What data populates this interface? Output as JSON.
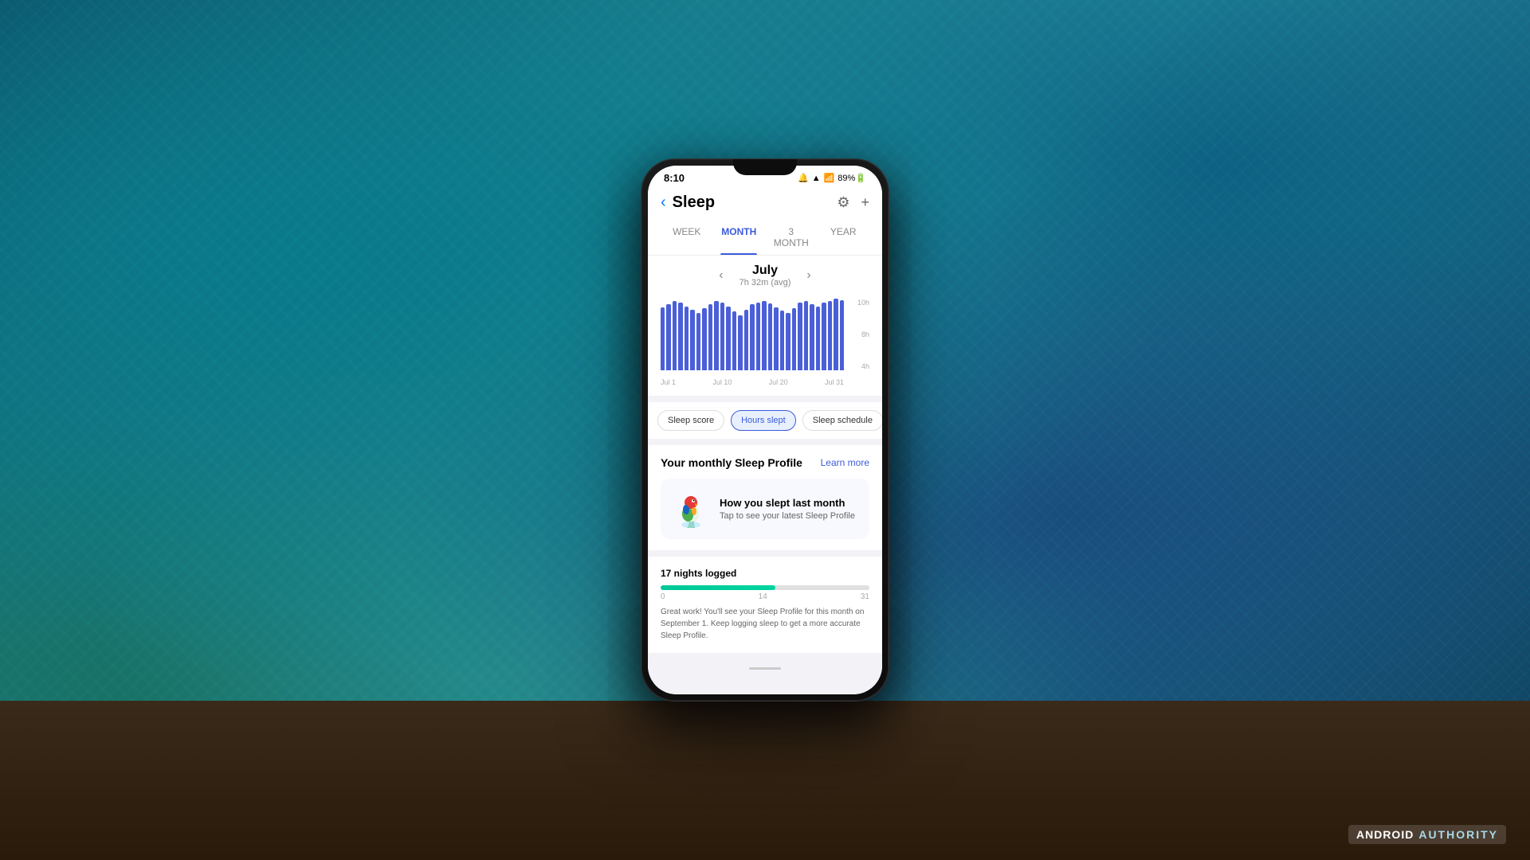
{
  "background": {
    "colors": [
      "#0e4a60",
      "#1a7a8a",
      "#2a90a0"
    ]
  },
  "status_bar": {
    "time": "8:10",
    "icons": "🔔 📶 📶 89%"
  },
  "header": {
    "title": "Sleep",
    "back_label": "‹",
    "settings_icon": "⚙",
    "add_icon": "+"
  },
  "tabs": [
    {
      "label": "WEEK",
      "active": false
    },
    {
      "label": "MONTH",
      "active": true
    },
    {
      "label": "3 MONTH",
      "active": false
    },
    {
      "label": "YEAR",
      "active": false
    }
  ],
  "month_nav": {
    "prev": "‹",
    "next": "›",
    "month": "July",
    "avg": "7h 32m (avg)"
  },
  "chart": {
    "y_labels": [
      "10h",
      "8h",
      "4h"
    ],
    "x_labels": [
      "Jul 1",
      "Jul 10",
      "Jul 20",
      "Jul 31"
    ],
    "bars": [
      75,
      78,
      82,
      80,
      76,
      72,
      68,
      74,
      78,
      82,
      80,
      76,
      70,
      65,
      72,
      78,
      80,
      82,
      79,
      75,
      71,
      68,
      74,
      80,
      82,
      78,
      76,
      80,
      82,
      85,
      83
    ]
  },
  "filter_chips": [
    {
      "label": "Sleep score",
      "active": false
    },
    {
      "label": "Hours slept",
      "active": true
    },
    {
      "label": "Sleep schedule",
      "active": false
    }
  ],
  "sleep_profile": {
    "section_title": "Your monthly Sleep Profile",
    "learn_more": "Learn more",
    "card": {
      "title": "How you slept last month",
      "subtitle": "Tap to see your latest Sleep Profile"
    }
  },
  "progress": {
    "label": "17 nights logged",
    "fill_percent": 55,
    "numbers": [
      "0",
      "14",
      "31"
    ],
    "description": "Great work! You'll see your Sleep Profile for this month on September 1. Keep logging sleep to get a more accurate Sleep Profile."
  },
  "watermark": {
    "prefix": "ANDROID",
    "brand": "AUTHORITY"
  }
}
